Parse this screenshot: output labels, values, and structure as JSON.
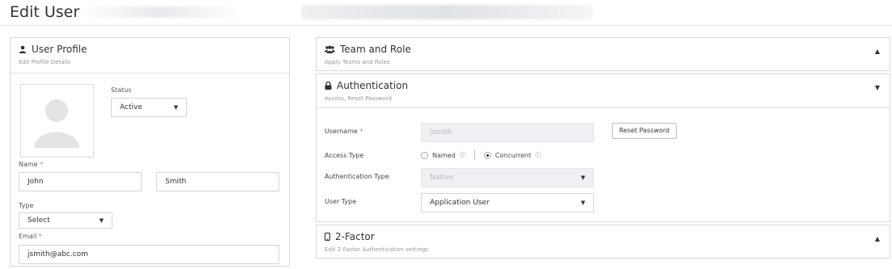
{
  "page": {
    "title": "Edit User"
  },
  "profile": {
    "title": "User Profile",
    "subtitle": "Edit Profile Details",
    "icon": "user-icon",
    "status_label": "Status",
    "status_value": "Active",
    "name_label": "Name",
    "required_mark": "*",
    "first_name": "John",
    "last_name": "Smith",
    "type_label": "Type",
    "type_value": "Select",
    "email_label": "Email",
    "email_value": "jsmith@abc.com"
  },
  "team": {
    "title": "Team and Role",
    "subtitle": "Apply Teams and Roles",
    "icon": "users-icon",
    "caret": "▲"
  },
  "auth": {
    "title": "Authentication",
    "subtitle": "Access, Reset Password",
    "icon": "lock-icon",
    "caret": "▼",
    "username_label": "Username",
    "username_value": "jsmith",
    "reset_button": "Reset Password",
    "access_type_label": "Access Type",
    "access_named": "Named",
    "access_concurrent": "Concurrent",
    "info_glyph": "ⓘ",
    "auth_type_label": "Authentication Type",
    "auth_type_value": "Native",
    "user_type_label": "User Type",
    "user_type_value": "Application User"
  },
  "twofa": {
    "title": "2-Factor",
    "subtitle": "Edit 2-Factor Authentication settings",
    "icon": "mobile-icon",
    "caret": "▲"
  },
  "colors": {
    "border": "#d9d9d9",
    "required": "#e07070",
    "disabled_bg": "#eef0f3"
  }
}
